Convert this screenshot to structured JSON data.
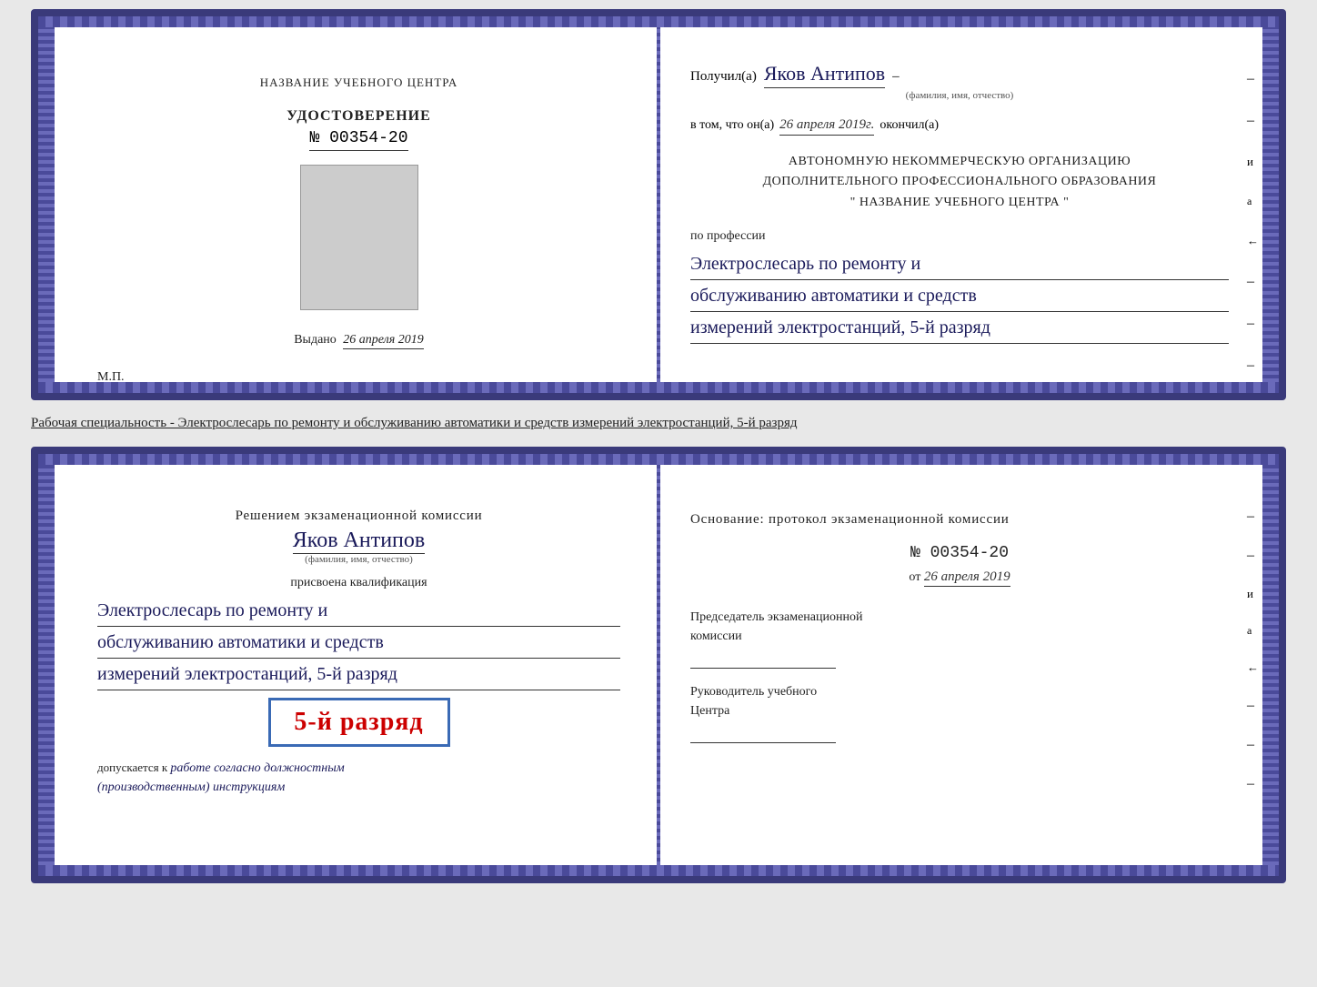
{
  "doc_top": {
    "left": {
      "center_title": "НАЗВАНИЕ УЧЕБНОГО ЦЕНТРА",
      "cert_type": "УДОСТОВЕРЕНИЕ",
      "cert_number": "№ 00354-20",
      "issued_label": "Выдано",
      "issued_date": "26 апреля 2019",
      "mp_label": "М.П."
    },
    "right": {
      "recipient_prefix": "Получил(а)",
      "recipient_name": "Яков Антипов",
      "recipient_subtitle": "(фамилия, имя, отчество)",
      "confirm_line": "в том, что он(а)",
      "confirm_date": "26 апреля 2019г.",
      "confirm_suffix": "окончил(а)",
      "org_line1": "АВТОНОМНУЮ НЕКОММЕРЧЕСКУЮ ОРГАНИЗАЦИЮ",
      "org_line2": "ДОПОЛНИТЕЛЬНОГО ПРОФЕССИОНАЛЬНОГО ОБРАЗОВАНИЯ",
      "org_line3": "\" НАЗВАНИЕ УЧЕБНОГО ЦЕНТРА \"",
      "profession_label": "по профессии",
      "profession_line1": "Электрослесарь по ремонту и",
      "profession_line2": "обслуживанию автоматики и средств",
      "profession_line3": "измерений электростанций, 5-й разряд"
    }
  },
  "separator": {
    "text": "Рабочая специальность - Электрослесарь по ремонту и обслуживанию автоматики и средств измерений электростанций, 5-й разряд"
  },
  "doc_bottom": {
    "left": {
      "decision_text": "Решением экзаменационной комиссии",
      "name": "Яков Антипов",
      "name_subtitle": "(фамилия, имя, отчество)",
      "qualification_label": "присвоена квалификация",
      "qual_line1": "Электрослесарь по ремонту и",
      "qual_line2": "обслуживанию автоматики и средств",
      "qual_line3": "измерений электростанций, 5-й разряд",
      "grade_text": "5-й разряд",
      "allowed_prefix": "допускается к",
      "allowed_text": "работе согласно должностным",
      "allowed_text2": "(производственным) инструкциям"
    },
    "right": {
      "basis_line1": "Основание: протокол экзаменационной комиссии",
      "protocol_number": "№ 00354-20",
      "protocol_date_prefix": "от",
      "protocol_date": "26 апреля 2019",
      "chairman_label": "Председатель экзаменационной",
      "chairman_label2": "комиссии",
      "director_label": "Руководитель учебного",
      "director_label2": "Центра"
    }
  }
}
